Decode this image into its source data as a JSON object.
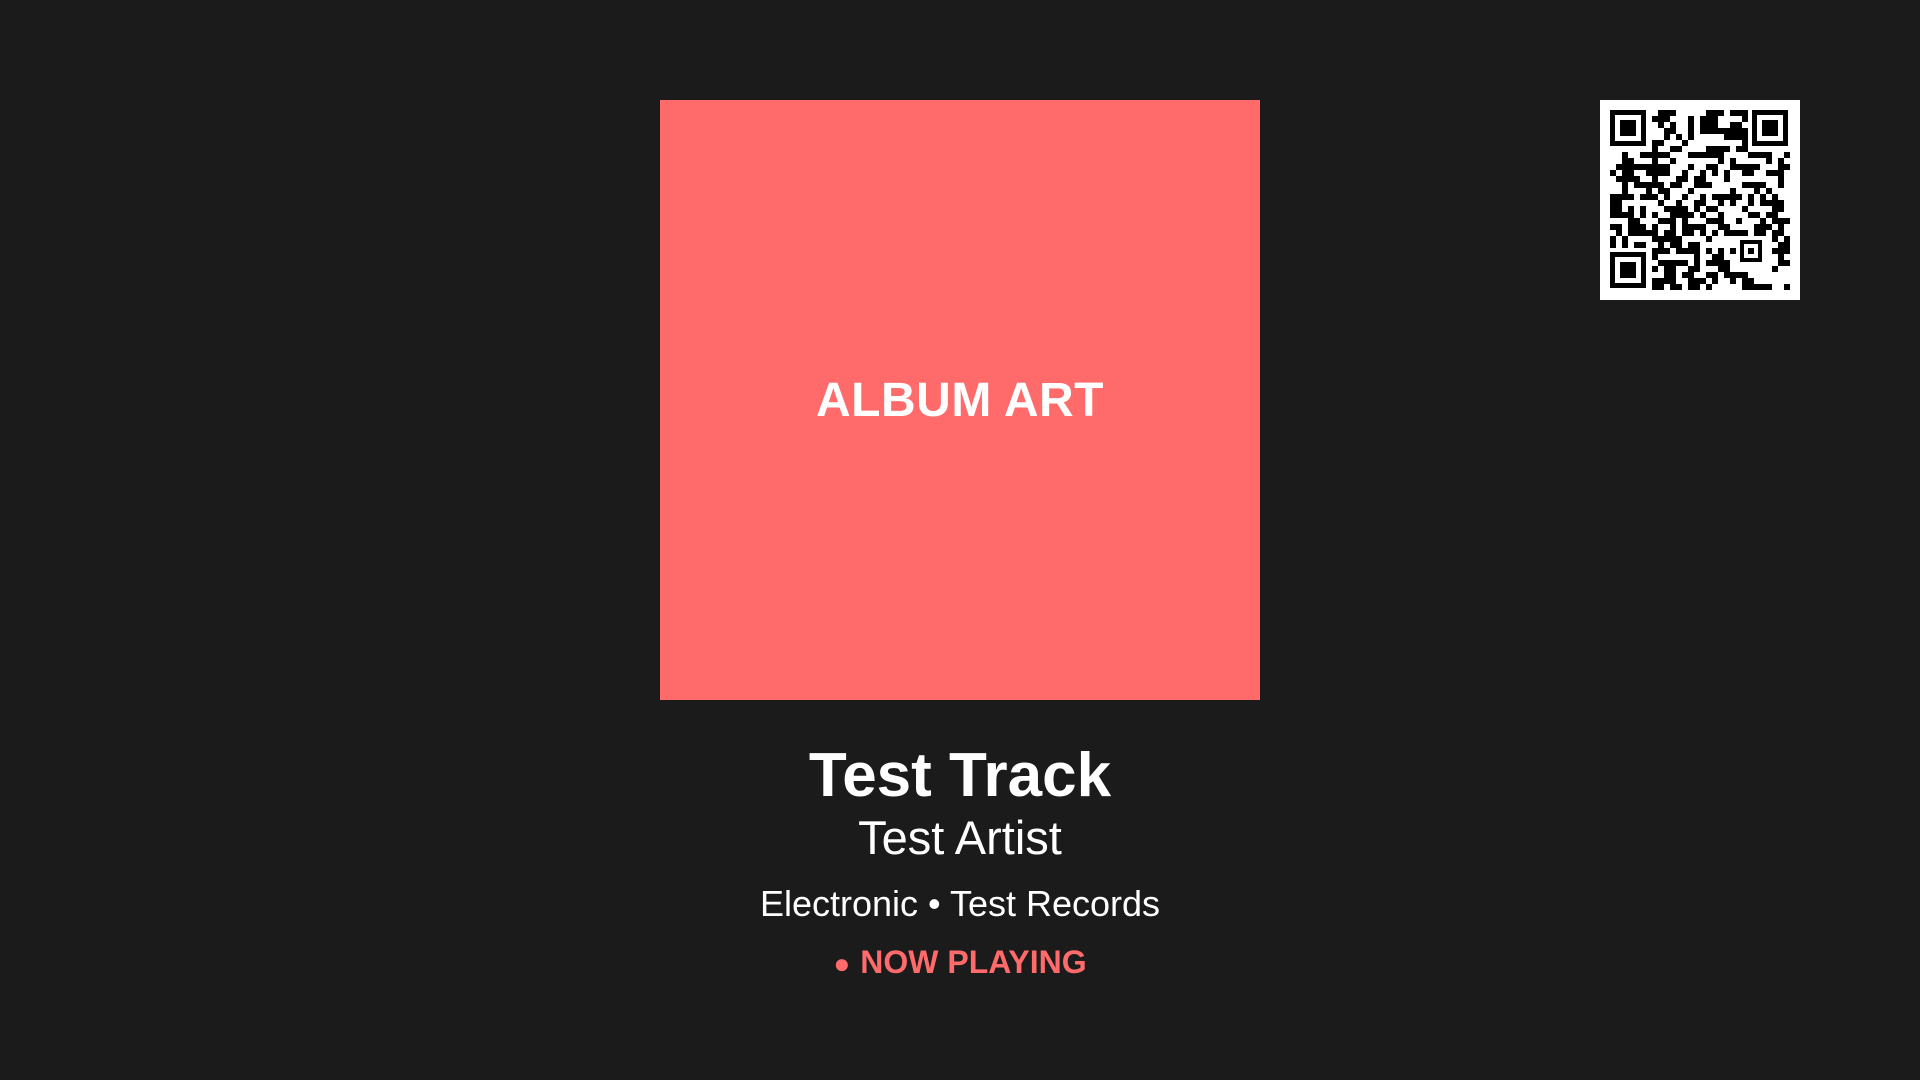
{
  "album": {
    "art_label": "ALBUM ART",
    "art_color": "#ff6b6b"
  },
  "track": {
    "title": "Test Track",
    "artist": "Test Artist",
    "genre": "Electronic",
    "separator": "•",
    "label": "Test Records"
  },
  "status": {
    "dot": "●",
    "text": "NOW PLAYING",
    "color": "#ff6b6b"
  },
  "qr": {
    "icon": "qr-code-icon"
  },
  "colors": {
    "background": "#1b1b1b",
    "text": "#ffffff"
  }
}
